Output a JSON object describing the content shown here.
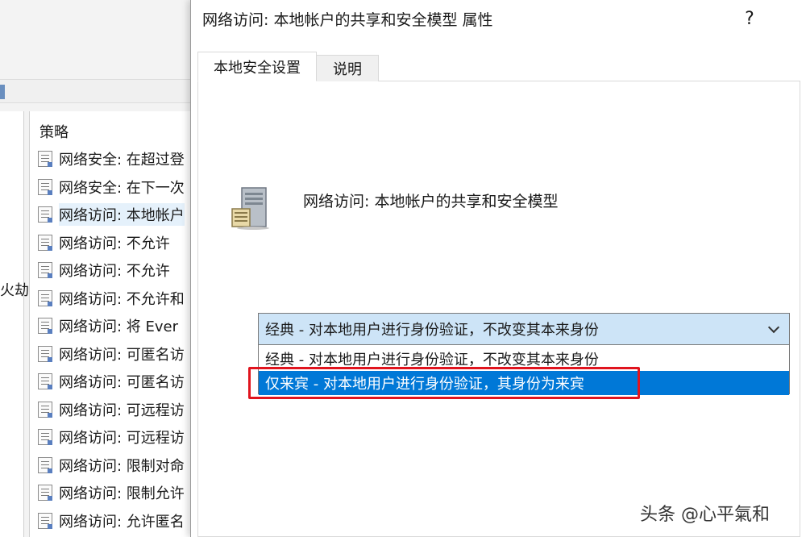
{
  "background_window": {
    "tree_partial_text": "火劫",
    "list_header": "策略",
    "policies": [
      "网络安全: 在超过登",
      "网络安全: 在下一次",
      "网络访问: 本地帐户",
      "网络访问: 不允许",
      "网络访问: 不允许",
      "网络访问: 不允许和",
      "网络访问: 将 Ever",
      "网络访问: 可匿名访",
      "网络访问: 可匿名访",
      "网络访问: 可远程访",
      "网络访问: 可远程访",
      "网络访问: 限制对命",
      "网络访问: 限制允许",
      "网络访问: 允许匿名"
    ]
  },
  "dialog": {
    "title": "网络访问: 本地帐户的共享和安全模型 属性",
    "help_label": "?",
    "tabs": [
      {
        "label": "本地安全设置",
        "active": true
      },
      {
        "label": "说明",
        "active": false
      }
    ],
    "policy_name": "网络访问: 本地帐户的共享和安全模型",
    "select": {
      "selected_value": "经典 - 对本地用户进行身份验证，不改变其本来身份",
      "options": [
        "经典 - 对本地用户进行身份验证，不改变其本来身份",
        "仅来宾 - 对本地用户进行身份验证，其身份为来宾"
      ]
    }
  },
  "annotation": {
    "color": "#e0141e"
  },
  "colors": {
    "selection": "#0078d7",
    "select_bg": "#cde4f7"
  },
  "watermark": "头条 @心平氣和"
}
